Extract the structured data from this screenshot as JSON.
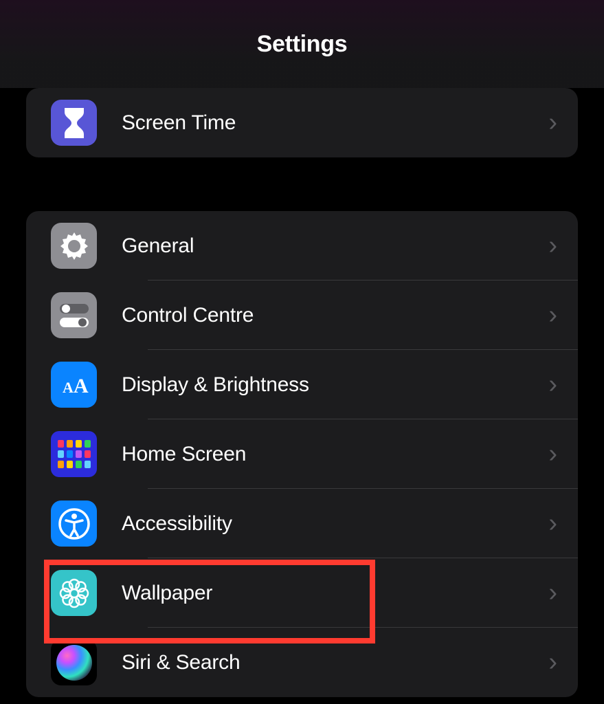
{
  "header": {
    "title": "Settings"
  },
  "colors": {
    "accent_purple": "#5856d6",
    "accent_blue": "#0a84ff",
    "highlight_red": "#ff3b30",
    "system_gray": "#8e8e93",
    "wallpaper_teal": "#35c4c9"
  },
  "groups": [
    {
      "items": [
        {
          "key": "screen-time",
          "label": "Screen Time",
          "icon": "hourglass-icon"
        }
      ]
    },
    {
      "items": [
        {
          "key": "general",
          "label": "General",
          "icon": "gear-icon"
        },
        {
          "key": "control-centre",
          "label": "Control Centre",
          "icon": "toggles-icon"
        },
        {
          "key": "display-brightness",
          "label": "Display & Brightness",
          "icon": "text-size-icon"
        },
        {
          "key": "home-screen",
          "label": "Home Screen",
          "icon": "app-grid-icon"
        },
        {
          "key": "accessibility",
          "label": "Accessibility",
          "icon": "accessibility-icon",
          "highlighted": true
        },
        {
          "key": "wallpaper",
          "label": "Wallpaper",
          "icon": "flower-icon"
        },
        {
          "key": "siri-search",
          "label": "Siri & Search",
          "icon": "siri-orb-icon"
        }
      ]
    }
  ]
}
